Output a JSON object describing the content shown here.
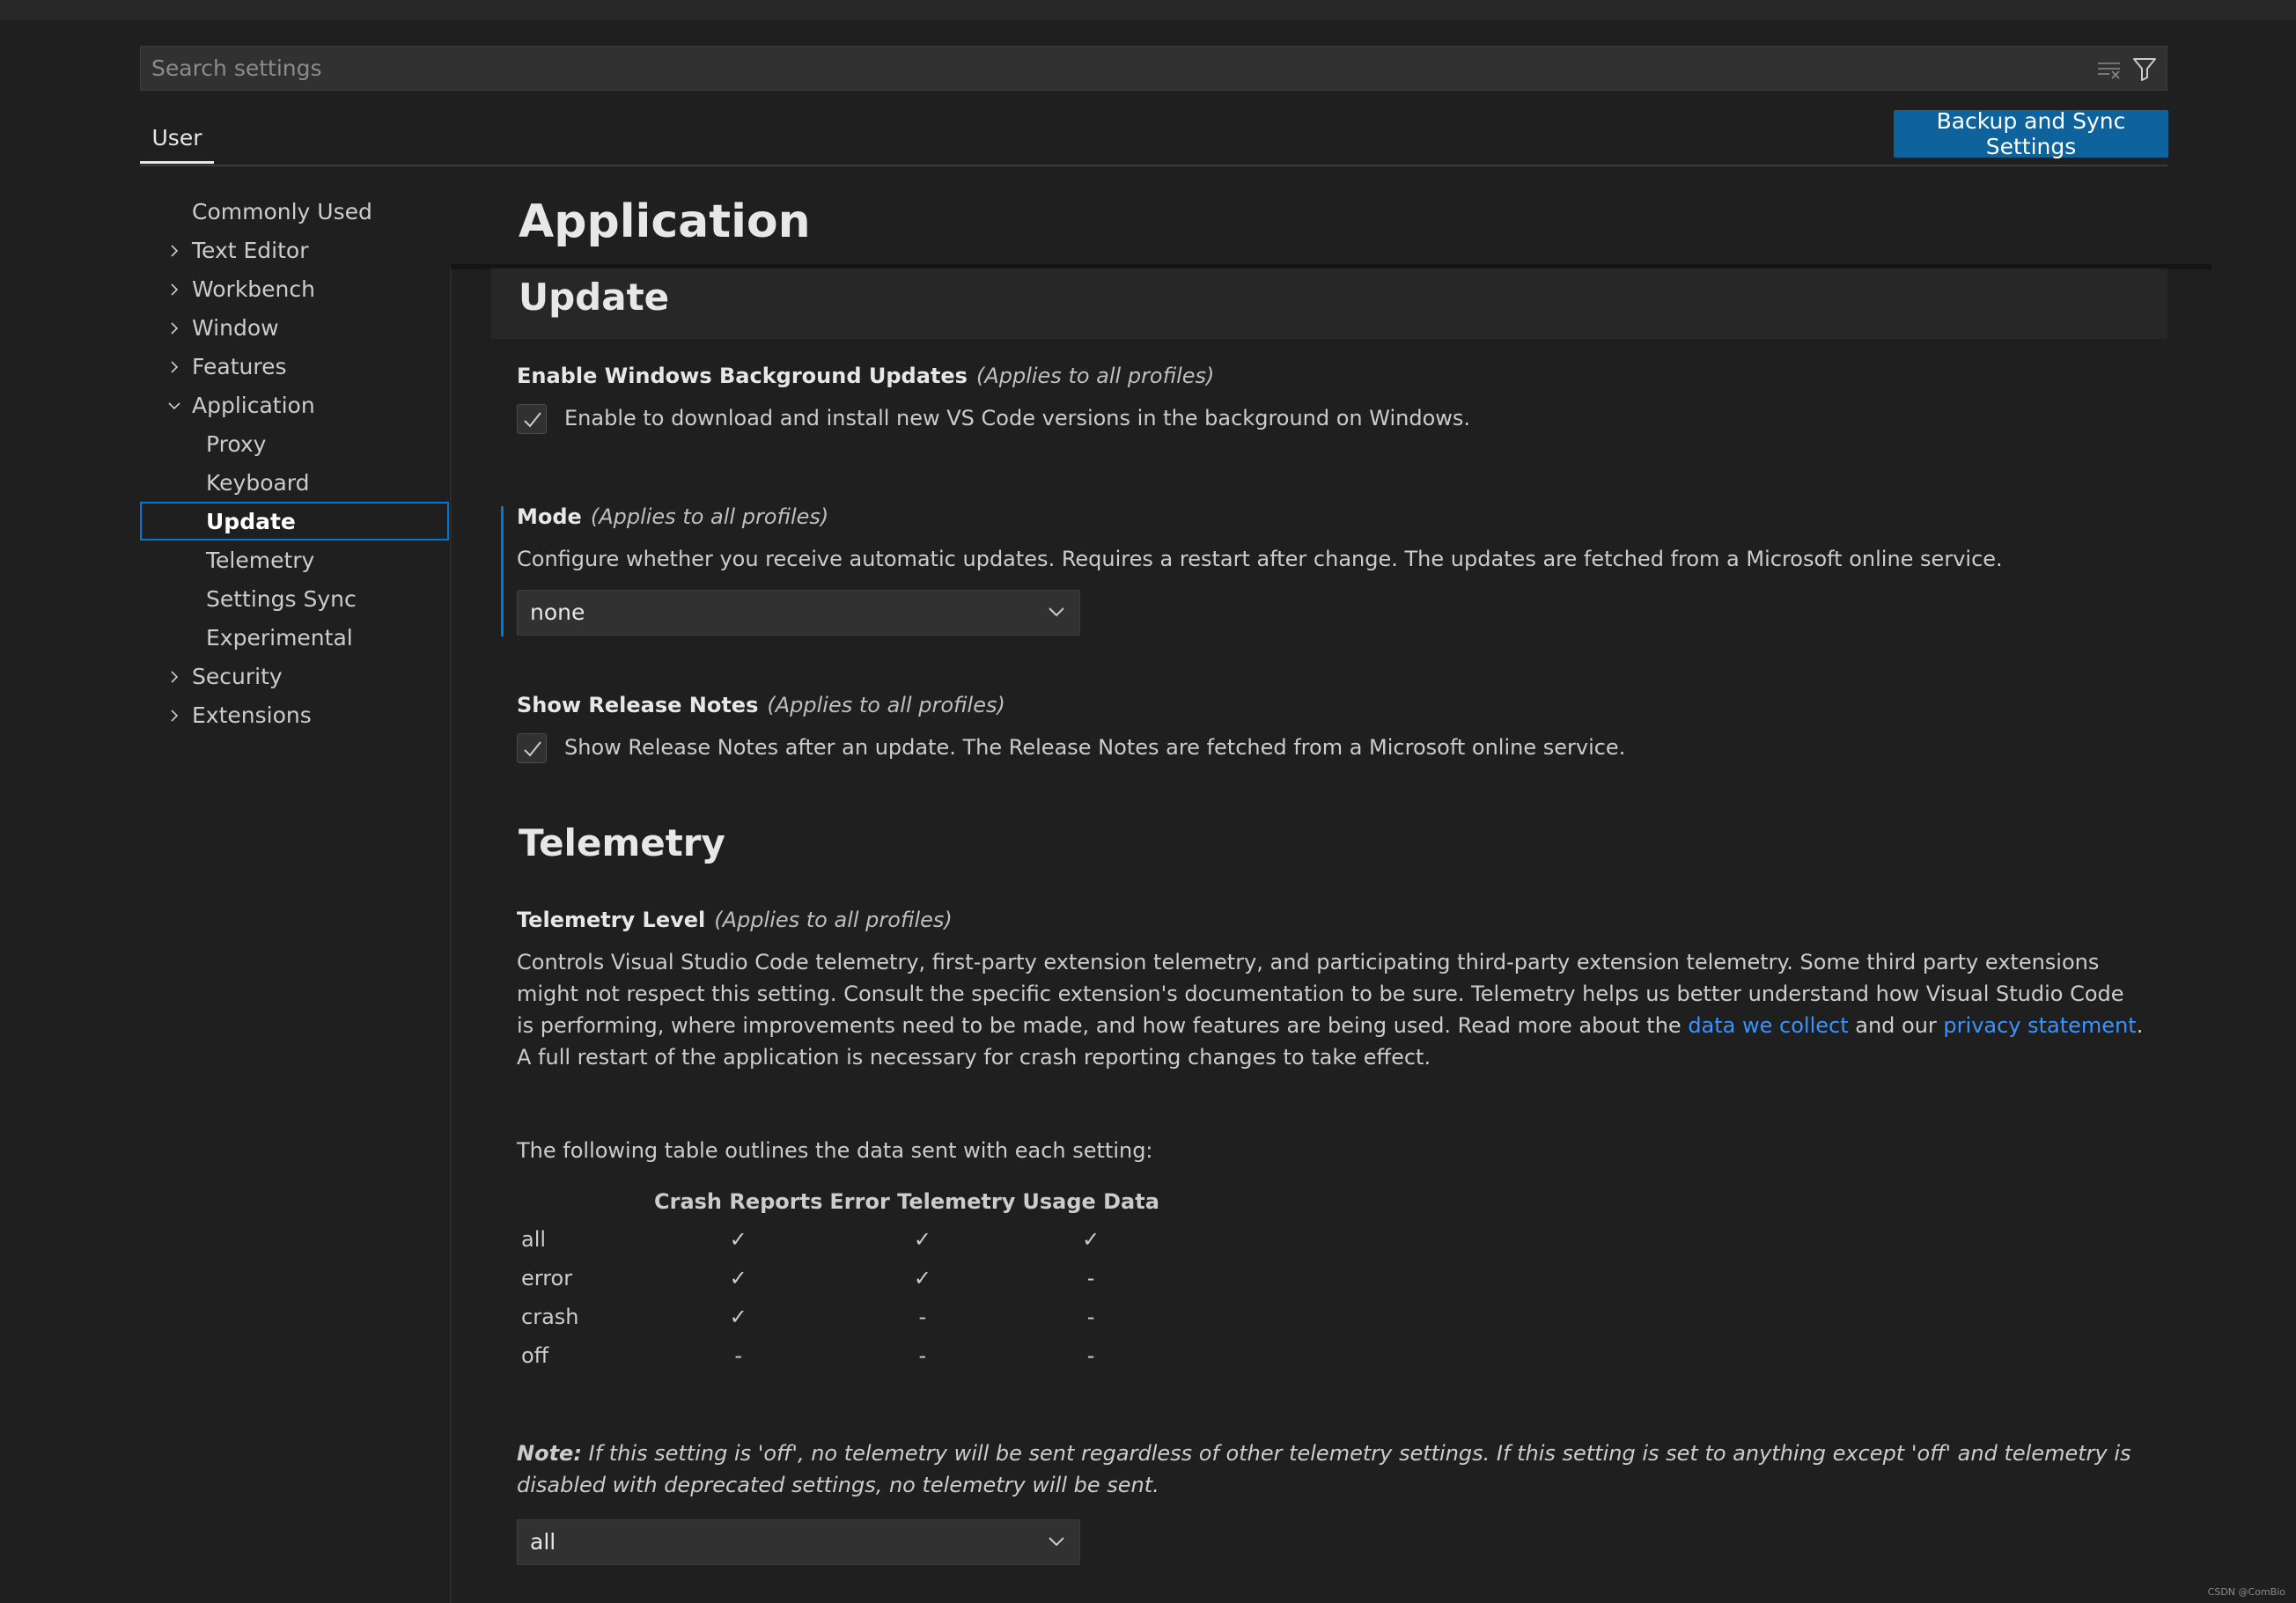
{
  "search": {
    "placeholder": "Search settings"
  },
  "header": {
    "tab_user": "User",
    "sync_button": "Backup and Sync Settings"
  },
  "toc": {
    "items": [
      {
        "label": "Commonly Used",
        "chevron": "none"
      },
      {
        "label": "Text Editor",
        "chevron": "right"
      },
      {
        "label": "Workbench",
        "chevron": "right"
      },
      {
        "label": "Window",
        "chevron": "right"
      },
      {
        "label": "Features",
        "chevron": "right"
      },
      {
        "label": "Application",
        "chevron": "down"
      },
      {
        "label": "Proxy",
        "chevron": "none"
      },
      {
        "label": "Keyboard",
        "chevron": "none"
      },
      {
        "label": "Update",
        "chevron": "none",
        "selected": true
      },
      {
        "label": "Telemetry",
        "chevron": "none"
      },
      {
        "label": "Settings Sync",
        "chevron": "none"
      },
      {
        "label": "Experimental",
        "chevron": "none"
      },
      {
        "label": "Security",
        "chevron": "right"
      },
      {
        "label": "Extensions",
        "chevron": "right"
      }
    ]
  },
  "content": {
    "page_title": "Application",
    "update": {
      "title": "Update",
      "bg_updates": {
        "title": "Enable Windows Background Updates",
        "scope": "(Applies to all profiles)",
        "desc": "Enable to download and install new VS Code versions in the background on Windows.",
        "checked": true
      },
      "mode": {
        "title": "Mode",
        "scope": "(Applies to all profiles)",
        "desc": "Configure whether you receive automatic updates. Requires a restart after change. The updates are fetched from a Microsoft online service.",
        "value": "none"
      },
      "release_notes": {
        "title": "Show Release Notes",
        "scope": "(Applies to all profiles)",
        "desc": "Show Release Notes after an update. The Release Notes are fetched from a Microsoft online service.",
        "checked": true
      }
    },
    "telemetry": {
      "title": "Telemetry",
      "level": {
        "title": "Telemetry Level",
        "scope": "(Applies to all profiles)",
        "desc_part1": "Controls Visual Studio Code telemetry, first-party extension telemetry, and participating third-party extension telemetry. Some third party extensions might not respect this setting. Consult the specific extension's documentation to be sure. Telemetry helps us better understand how Visual Studio Code is performing, where improvements need to be made, and how features are being used. Read more about the ",
        "link1": "data we collect",
        "desc_part2": " and our ",
        "link2": "privacy statement",
        "desc_part3": ". A full restart of the application is necessary for crash reporting changes to take effect.",
        "table_intro": "The following table outlines the data sent with each setting:",
        "table_headers": [
          "",
          "Crash Reports",
          "Error Telemetry",
          "Usage Data"
        ],
        "table_rows": [
          [
            "all",
            "✓",
            "✓",
            "✓"
          ],
          [
            "error",
            "✓",
            "✓",
            "-"
          ],
          [
            "crash",
            "✓",
            "-",
            "-"
          ],
          [
            "off",
            "-",
            "-",
            "-"
          ]
        ],
        "note_label": "Note:",
        "note_text": " If this setting is 'off', no telemetry will be sent regardless of other telemetry settings. If this setting is set to anything except 'off' and telemetry is disabled with deprecated settings, no telemetry will be sent.",
        "value": "all"
      }
    }
  },
  "watermark": "CSDN @ComBio",
  "colors": {
    "accent": "#0078d4",
    "button": "#0e639c",
    "link": "#3794ff",
    "background": "#1f1f1f"
  }
}
